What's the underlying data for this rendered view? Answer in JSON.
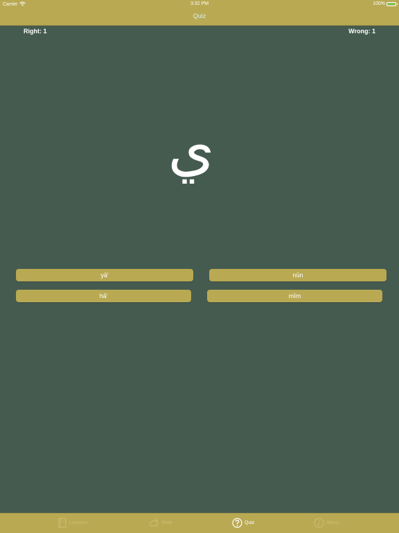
{
  "status_bar": {
    "carrier": "Carrier",
    "time": "3:32 PM",
    "battery": "100%"
  },
  "nav": {
    "title": "Quiz"
  },
  "score": {
    "right": "Right: 1",
    "wrong": "Wrong: 1"
  },
  "quiz": {
    "letter": "ي",
    "answers": [
      "yā'",
      "nūn",
      "hā'",
      "mīm"
    ]
  },
  "tabs": [
    {
      "label": "Lessons",
      "icon": "book-icon",
      "active": false
    },
    {
      "label": "Write",
      "icon": "pencil-hand-icon",
      "active": false
    },
    {
      "label": "Quiz",
      "icon": "question-icon",
      "active": true
    },
    {
      "label": "About",
      "icon": "info-icon",
      "active": false
    }
  ],
  "colors": {
    "background": "#455b50",
    "accent": "#b9a953",
    "nav_title": "#d9f2ee"
  }
}
